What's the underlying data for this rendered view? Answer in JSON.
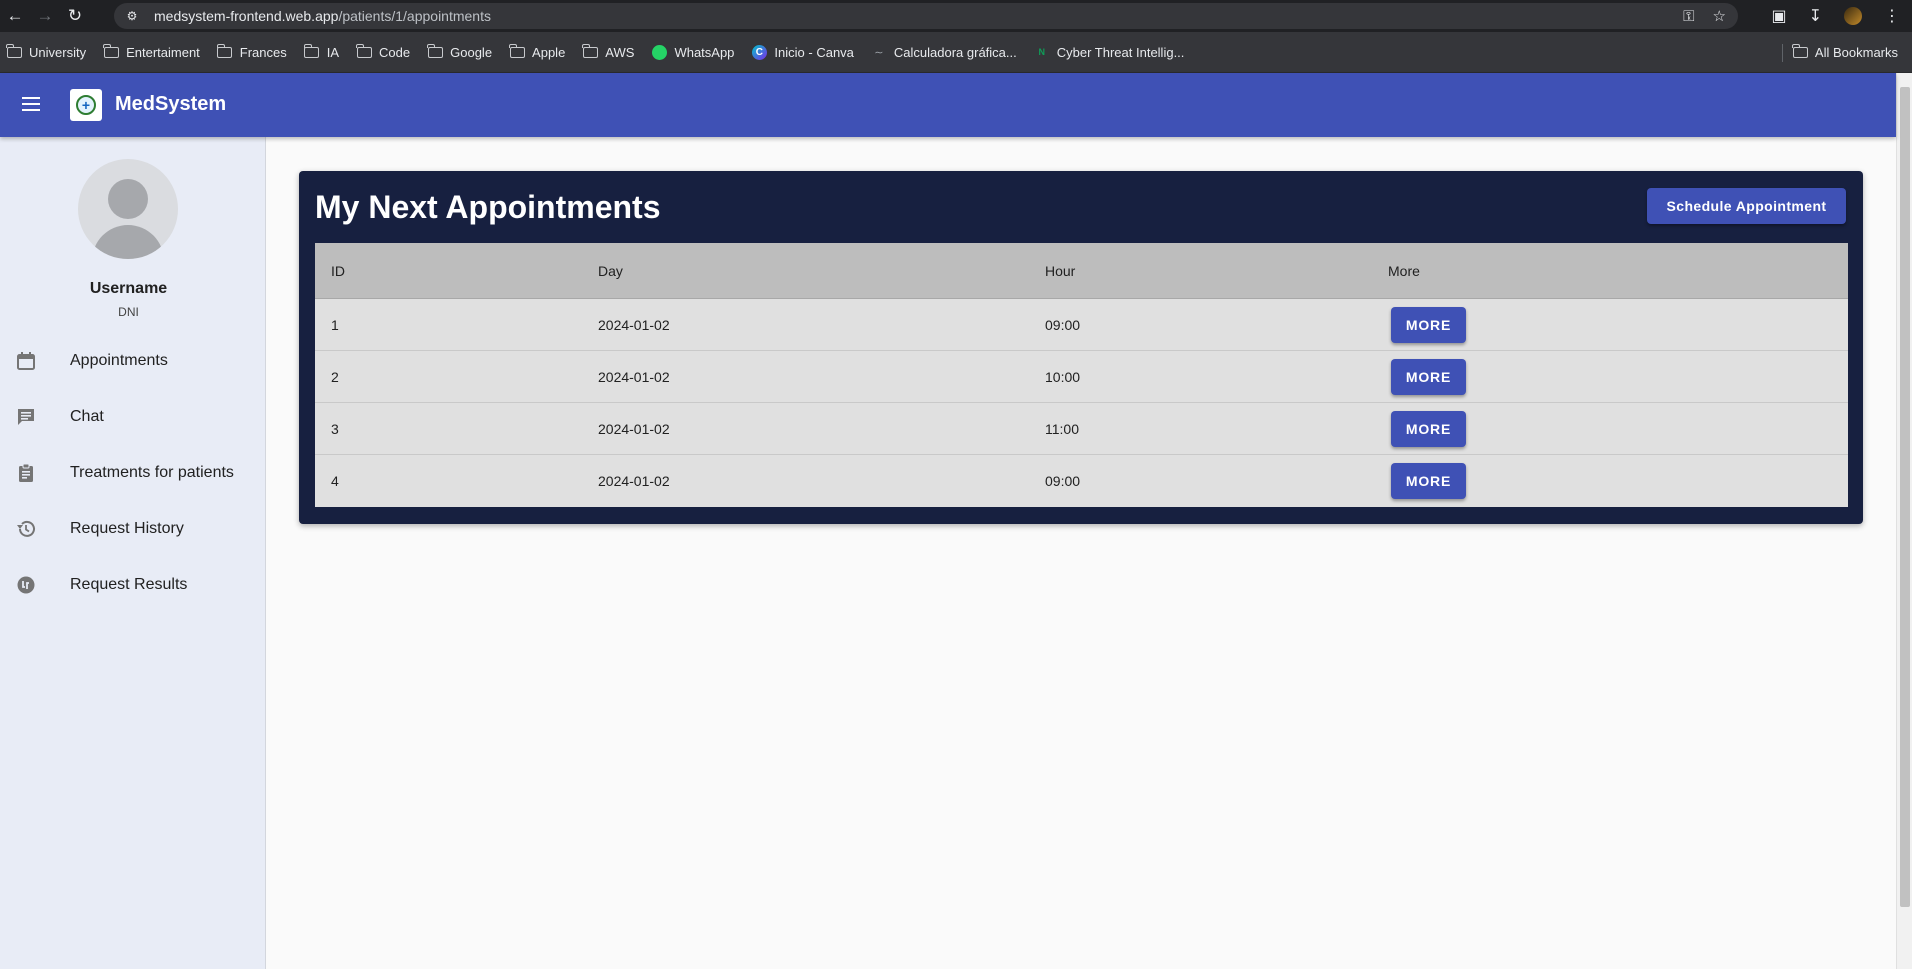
{
  "browser": {
    "url_host": "medsystem-frontend.web.app",
    "url_path": "/patients/1/appointments",
    "bookmarks": [
      "University",
      "Entertaiment",
      "Frances",
      "IA",
      "Code",
      "Google",
      "Apple",
      "AWS",
      "WhatsApp",
      "Inicio - Canva",
      "Calculadora gráfica...",
      "Cyber Threat Intellig..."
    ],
    "all_bookmarks_label": "All Bookmarks"
  },
  "app": {
    "brand": "MedSystem"
  },
  "sidebar": {
    "username": "Username",
    "dni": "DNI",
    "items": [
      {
        "label": "Appointments",
        "icon": "calendar-icon"
      },
      {
        "label": "Chat",
        "icon": "chat-icon"
      },
      {
        "label": "Treatments for patients",
        "icon": "clipboard-icon"
      },
      {
        "label": "Request History",
        "icon": "history-icon"
      },
      {
        "label": "Request Results",
        "icon": "results-icon"
      }
    ]
  },
  "main": {
    "title": "My Next Appointments",
    "schedule_label": "Schedule Appointment",
    "columns": [
      "ID",
      "Day",
      "Hour",
      "More"
    ],
    "more_label": "MORE",
    "rows": [
      {
        "id": "1",
        "day": "2024-01-02",
        "hour": "09:00"
      },
      {
        "id": "2",
        "day": "2024-01-02",
        "hour": "10:00"
      },
      {
        "id": "3",
        "day": "2024-01-02",
        "hour": "11:00"
      },
      {
        "id": "4",
        "day": "2024-01-02",
        "hour": "09:00"
      }
    ]
  },
  "colors": {
    "primary": "#3f51b5",
    "card": "#172040",
    "sidebar": "#e8ecf6"
  }
}
